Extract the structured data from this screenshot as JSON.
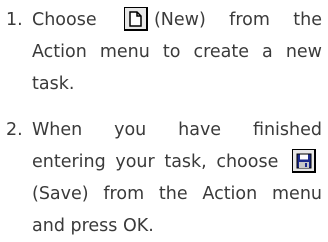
{
  "steps": [
    {
      "number": "1.",
      "before": "Choose",
      "icon": "new-document-icon",
      "after": "(New) from the Action menu to create a new task."
    },
    {
      "number": "2.",
      "before": "When you have finished entering your task, choose",
      "icon": "save-disk-icon",
      "after": "(Save) from the Action menu and press OK."
    }
  ]
}
